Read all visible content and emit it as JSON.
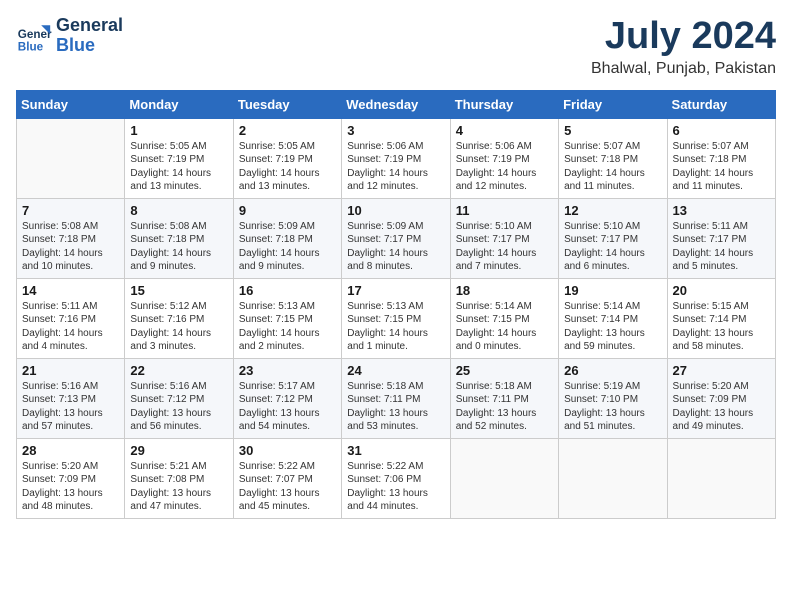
{
  "header": {
    "logo_line1": "General",
    "logo_line2": "Blue",
    "title": "July 2024",
    "subtitle": "Bhalwal, Punjab, Pakistan"
  },
  "weekdays": [
    "Sunday",
    "Monday",
    "Tuesday",
    "Wednesday",
    "Thursday",
    "Friday",
    "Saturday"
  ],
  "weeks": [
    [
      {
        "day": "",
        "info": ""
      },
      {
        "day": "1",
        "info": "Sunrise: 5:05 AM\nSunset: 7:19 PM\nDaylight: 14 hours\nand 13 minutes."
      },
      {
        "day": "2",
        "info": "Sunrise: 5:05 AM\nSunset: 7:19 PM\nDaylight: 14 hours\nand 13 minutes."
      },
      {
        "day": "3",
        "info": "Sunrise: 5:06 AM\nSunset: 7:19 PM\nDaylight: 14 hours\nand 12 minutes."
      },
      {
        "day": "4",
        "info": "Sunrise: 5:06 AM\nSunset: 7:19 PM\nDaylight: 14 hours\nand 12 minutes."
      },
      {
        "day": "5",
        "info": "Sunrise: 5:07 AM\nSunset: 7:18 PM\nDaylight: 14 hours\nand 11 minutes."
      },
      {
        "day": "6",
        "info": "Sunrise: 5:07 AM\nSunset: 7:18 PM\nDaylight: 14 hours\nand 11 minutes."
      }
    ],
    [
      {
        "day": "7",
        "info": "Sunrise: 5:08 AM\nSunset: 7:18 PM\nDaylight: 14 hours\nand 10 minutes."
      },
      {
        "day": "8",
        "info": "Sunrise: 5:08 AM\nSunset: 7:18 PM\nDaylight: 14 hours\nand 9 minutes."
      },
      {
        "day": "9",
        "info": "Sunrise: 5:09 AM\nSunset: 7:18 PM\nDaylight: 14 hours\nand 9 minutes."
      },
      {
        "day": "10",
        "info": "Sunrise: 5:09 AM\nSunset: 7:17 PM\nDaylight: 14 hours\nand 8 minutes."
      },
      {
        "day": "11",
        "info": "Sunrise: 5:10 AM\nSunset: 7:17 PM\nDaylight: 14 hours\nand 7 minutes."
      },
      {
        "day": "12",
        "info": "Sunrise: 5:10 AM\nSunset: 7:17 PM\nDaylight: 14 hours\nand 6 minutes."
      },
      {
        "day": "13",
        "info": "Sunrise: 5:11 AM\nSunset: 7:17 PM\nDaylight: 14 hours\nand 5 minutes."
      }
    ],
    [
      {
        "day": "14",
        "info": "Sunrise: 5:11 AM\nSunset: 7:16 PM\nDaylight: 14 hours\nand 4 minutes."
      },
      {
        "day": "15",
        "info": "Sunrise: 5:12 AM\nSunset: 7:16 PM\nDaylight: 14 hours\nand 3 minutes."
      },
      {
        "day": "16",
        "info": "Sunrise: 5:13 AM\nSunset: 7:15 PM\nDaylight: 14 hours\nand 2 minutes."
      },
      {
        "day": "17",
        "info": "Sunrise: 5:13 AM\nSunset: 7:15 PM\nDaylight: 14 hours\nand 1 minute."
      },
      {
        "day": "18",
        "info": "Sunrise: 5:14 AM\nSunset: 7:15 PM\nDaylight: 14 hours\nand 0 minutes."
      },
      {
        "day": "19",
        "info": "Sunrise: 5:14 AM\nSunset: 7:14 PM\nDaylight: 13 hours\nand 59 minutes."
      },
      {
        "day": "20",
        "info": "Sunrise: 5:15 AM\nSunset: 7:14 PM\nDaylight: 13 hours\nand 58 minutes."
      }
    ],
    [
      {
        "day": "21",
        "info": "Sunrise: 5:16 AM\nSunset: 7:13 PM\nDaylight: 13 hours\nand 57 minutes."
      },
      {
        "day": "22",
        "info": "Sunrise: 5:16 AM\nSunset: 7:12 PM\nDaylight: 13 hours\nand 56 minutes."
      },
      {
        "day": "23",
        "info": "Sunrise: 5:17 AM\nSunset: 7:12 PM\nDaylight: 13 hours\nand 54 minutes."
      },
      {
        "day": "24",
        "info": "Sunrise: 5:18 AM\nSunset: 7:11 PM\nDaylight: 13 hours\nand 53 minutes."
      },
      {
        "day": "25",
        "info": "Sunrise: 5:18 AM\nSunset: 7:11 PM\nDaylight: 13 hours\nand 52 minutes."
      },
      {
        "day": "26",
        "info": "Sunrise: 5:19 AM\nSunset: 7:10 PM\nDaylight: 13 hours\nand 51 minutes."
      },
      {
        "day": "27",
        "info": "Sunrise: 5:20 AM\nSunset: 7:09 PM\nDaylight: 13 hours\nand 49 minutes."
      }
    ],
    [
      {
        "day": "28",
        "info": "Sunrise: 5:20 AM\nSunset: 7:09 PM\nDaylight: 13 hours\nand 48 minutes."
      },
      {
        "day": "29",
        "info": "Sunrise: 5:21 AM\nSunset: 7:08 PM\nDaylight: 13 hours\nand 47 minutes."
      },
      {
        "day": "30",
        "info": "Sunrise: 5:22 AM\nSunset: 7:07 PM\nDaylight: 13 hours\nand 45 minutes."
      },
      {
        "day": "31",
        "info": "Sunrise: 5:22 AM\nSunset: 7:06 PM\nDaylight: 13 hours\nand 44 minutes."
      },
      {
        "day": "",
        "info": ""
      },
      {
        "day": "",
        "info": ""
      },
      {
        "day": "",
        "info": ""
      }
    ]
  ]
}
